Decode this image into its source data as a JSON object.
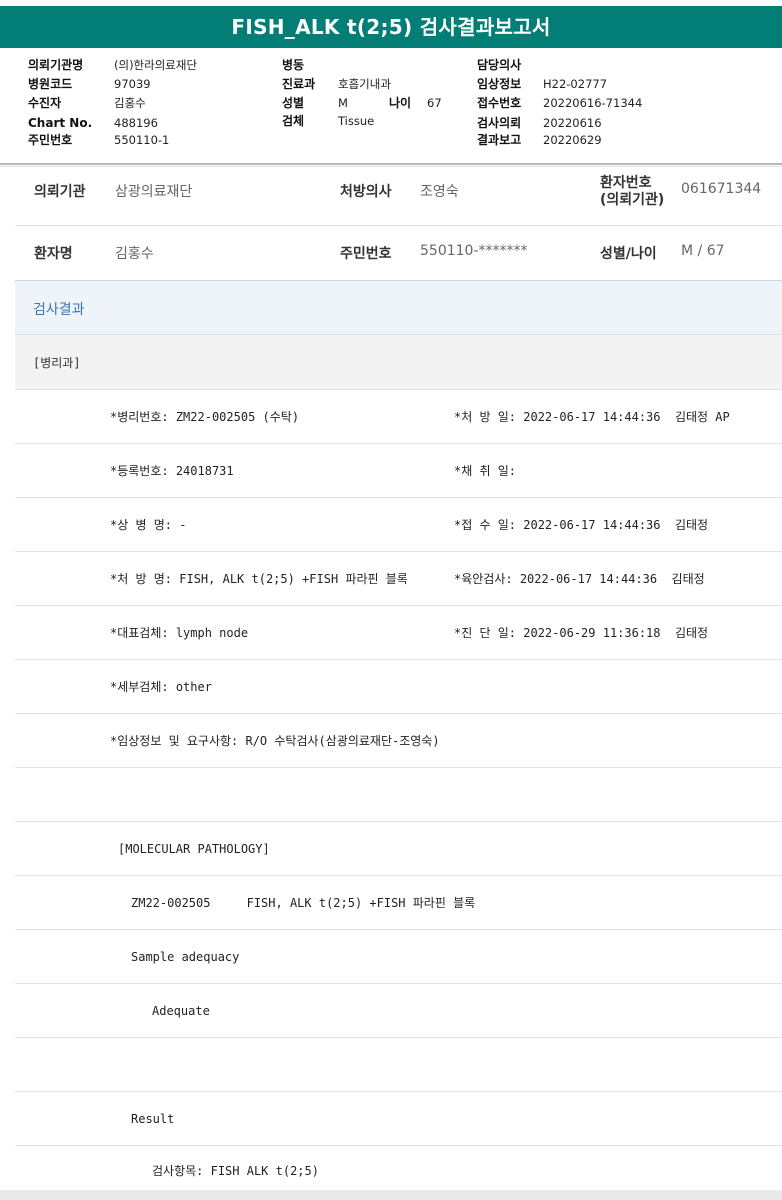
{
  "report_title": "FISH_ALK t(2;5) 검사결과보고서",
  "header": {
    "col1": [
      {
        "label": "의뢰기관명",
        "value": "(의)한라의료재단"
      },
      {
        "label": "병원코드",
        "value": "97039"
      },
      {
        "label": "수진자",
        "value": "김홍수"
      },
      {
        "label": "Chart No.",
        "value": "488196"
      },
      {
        "label": "주민번호",
        "value": "550110-1"
      }
    ],
    "col2": [
      {
        "label": "병동",
        "value": ""
      },
      {
        "label": "진료과",
        "value": "호흡기내과"
      },
      {
        "label": "성별",
        "value": "M"
      },
      {
        "label": "검체",
        "value": "Tissue"
      }
    ],
    "age": {
      "label": "나이",
      "value": "67"
    },
    "col3": [
      {
        "label": "담당의사",
        "value": ""
      },
      {
        "label": "임상정보",
        "value": "H22-02777"
      },
      {
        "label": "접수번호",
        "value": "20220616-71344"
      },
      {
        "label": "검사의뢰",
        "value": "20220616"
      },
      {
        "label": "결과보고",
        "value": "20220629"
      }
    ]
  },
  "patient": {
    "institution_label": "의뢰기관",
    "institution": "삼광의료재단",
    "doctor_label": "처방의사",
    "doctor": "조영숙",
    "patient_no_label_1": "환자번호",
    "patient_no_label_2": "(의뢰기관)",
    "patient_no": "061671344",
    "name_label": "환자명",
    "name": "김홍수",
    "rrn_label": "주민번호",
    "rrn": "550110-*******",
    "sex_age_label": "성별/나이",
    "sex_age": "M / 67"
  },
  "sections": {
    "result": "검사결과",
    "dept": "[병리과]"
  },
  "details": {
    "left": [
      "*병리번호: ZM22-002505 (수탁)",
      "*등록번호: 24018731",
      "*상 병 명: -",
      "*처 방 명: FISH, ALK t(2;5) +FISH 파라핀 블록",
      "*대표검체: lymph node",
      "*세부검체: other",
      "*임상정보 및 요구사항: R/O 수탁검사(삼광의료재단-조영숙)"
    ],
    "right": [
      "*처 방 일: 2022-06-17 14:44:36  김태정 AP",
      "*채 취 일:",
      "*접 수 일: 2022-06-17 14:44:36  김태정",
      "*육안검사: 2022-06-17 14:44:36  김태정",
      "*진 단 일: 2022-06-29 11:36:18  김태정"
    ]
  },
  "molecular": {
    "heading": "[MOLECULAR PATHOLOGY]",
    "line1": "ZM22-002505     FISH, ALK t(2;5) +FISH 파라핀 블록",
    "sample_adequacy": "Sample adequacy",
    "adequate": "Adequate",
    "result": "Result",
    "test_item": "검사항목: FISH ALK t(2;5)"
  }
}
